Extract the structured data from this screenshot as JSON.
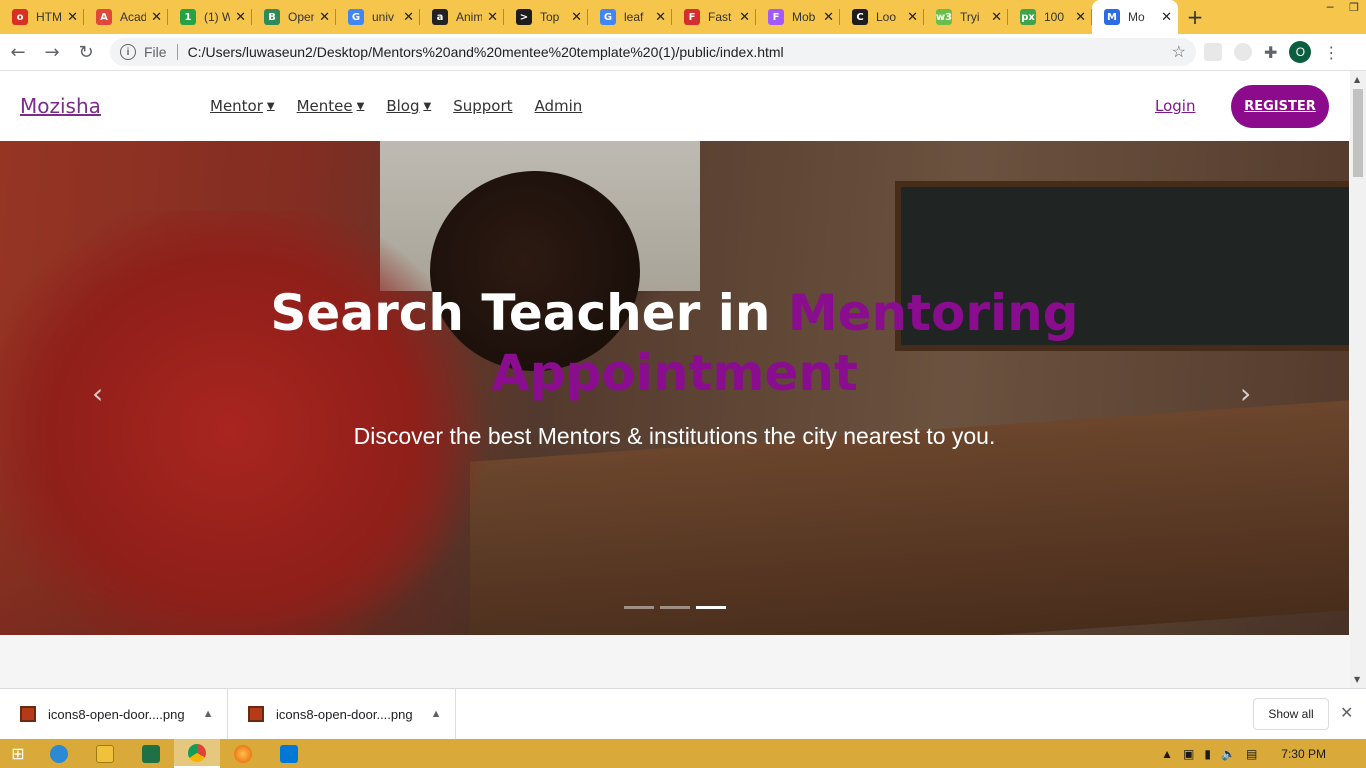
{
  "browser": {
    "tabs": [
      {
        "title": "HTML",
        "color": "#d93025",
        "glyph": "o"
      },
      {
        "title": "Academia",
        "color": "#e2473b",
        "glyph": "A"
      },
      {
        "title": "(1) W",
        "color": "#25a244",
        "glyph": "1"
      },
      {
        "title": "Open",
        "color": "#2e8b57",
        "glyph": "B"
      },
      {
        "title": "univ",
        "color": "#4285f4",
        "glyph": "G"
      },
      {
        "title": "Anim",
        "color": "#222222",
        "glyph": "a"
      },
      {
        "title": "Top",
        "color": "#1d1d1d",
        "glyph": ">"
      },
      {
        "title": "leaf",
        "color": "#4285f4",
        "glyph": "G"
      },
      {
        "title": "Fast",
        "color": "#d32f2f",
        "glyph": "F"
      },
      {
        "title": "Mob",
        "color": "#a259ff",
        "glyph": "F"
      },
      {
        "title": "Loo",
        "color": "#1d1d1d",
        "glyph": "C"
      },
      {
        "title": "Tryi",
        "color": "#6abf4b",
        "glyph": "w3"
      },
      {
        "title": "100",
        "color": "#3fa34d",
        "glyph": "px"
      }
    ],
    "active_tab": {
      "title": "Mo",
      "color": "#2d6cdf",
      "glyph": "M"
    },
    "url": "C:/Users/luwaseun2/Desktop/Mentors%20and%20mentee%20template%20(1)/public/index.html",
    "file_label": "File",
    "profile_initial": "O"
  },
  "site": {
    "logo": "Mozisha",
    "menu": [
      {
        "label": "Mentor",
        "dropdown": true
      },
      {
        "label": "Mentee",
        "dropdown": true
      },
      {
        "label": "Blog",
        "dropdown": true
      },
      {
        "label": "Support",
        "dropdown": false
      },
      {
        "label": "Admin",
        "dropdown": false
      }
    ],
    "login": "Login",
    "register": "REGISTER",
    "hero": {
      "title_white": "Search Teacher in",
      "title_highlight": "Mentoring",
      "title_line2": "Appointment",
      "subtitle": "Discover the best Mentors & institutions the city nearest to you.",
      "indicators": 3,
      "active_indicator": 2
    }
  },
  "downloads": {
    "items": [
      "icons8-open-door....png",
      "icons8-open-door....png"
    ],
    "show_all": "Show all"
  },
  "taskbar": {
    "time": "7:30 PM"
  }
}
